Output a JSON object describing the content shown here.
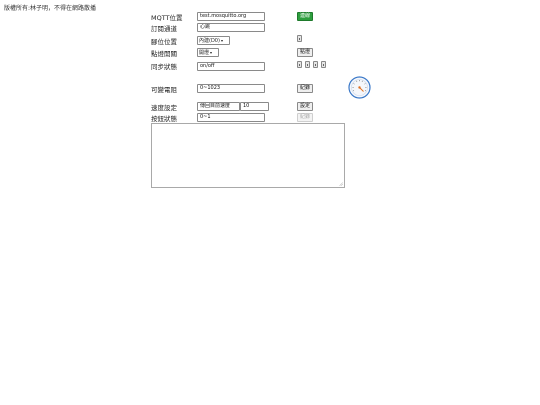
{
  "copyright": "版權所有:林子明，不得在網路散播",
  "labels": {
    "mqtt": "MQTT位置",
    "topic": "訂閱通道",
    "pin": "腳位位置",
    "switch": "點燈開關",
    "sync": "同步狀態",
    "pot": "可變電阻",
    "speed": "速度設定",
    "button": "按鈕狀態"
  },
  "inputs": {
    "mqtt_value": "test.mosquitto.org",
    "topic_value": "心跳",
    "sync_value": "on/off",
    "pot_value": "0~1023",
    "speed_mode_value": "傳回目前速度",
    "speed_value": "10",
    "button_value": "0~1"
  },
  "selects": {
    "pin_selected": "內建(D0)",
    "switch_selected": "開燈"
  },
  "buttons": {
    "connect": "連線",
    "light": "點燈",
    "record_pot": "紀錄",
    "set_speed": "設定",
    "record_button": "紀錄"
  },
  "icons": {
    "switch_icon": "toggle-switch-icon",
    "sync_icons": [
      "toggle-switch-icon",
      "toggle-switch-icon",
      "toggle-switch-icon",
      "toggle-switch-icon"
    ],
    "gauge": "gauge-dial-icon"
  },
  "colors": {
    "connect_bg": "#2e9e3e",
    "gauge_needle": "#e07020",
    "gauge_ring": "#3a78c8"
  }
}
